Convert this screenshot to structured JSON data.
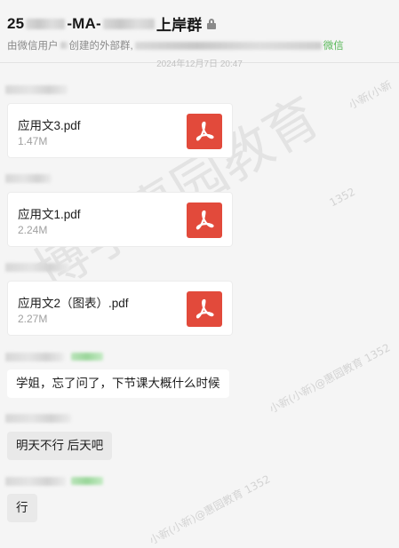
{
  "header": {
    "title_prefix": "25",
    "title_mid": "-MA-",
    "title_suffix": "上岸群",
    "subtitle_prefix": "由微信用户",
    "subtitle_mid": "创建的外部群,",
    "subtitle_suffix": "微信",
    "timestamp": "2024年12月7日 20:47"
  },
  "messages": [
    {
      "type": "file",
      "file_name": "应用文3.pdf",
      "file_size": "1.47M",
      "icon": "pdf-icon"
    },
    {
      "type": "file",
      "file_name": "应用文1.pdf",
      "file_size": "2.24M",
      "icon": "pdf-icon"
    },
    {
      "type": "file",
      "file_name": "应用文2（图表）.pdf",
      "file_size": "2.27M",
      "icon": "pdf-icon"
    },
    {
      "type": "text",
      "text": "学姐，忘了问了，下节课大概什么时候"
    },
    {
      "type": "text",
      "text": "明天不行 后天吧"
    },
    {
      "type": "text",
      "text": "行"
    }
  ],
  "watermarks": {
    "big": "博学惠园教育",
    "small_1": "小新(小新)@惠园教育 1352",
    "small_2": "小新(小新",
    "small_3": "1352"
  },
  "colors": {
    "pdf_red": "#e24a3b",
    "wechat_green": "#58b858",
    "page_bg": "#f5f5f5"
  }
}
